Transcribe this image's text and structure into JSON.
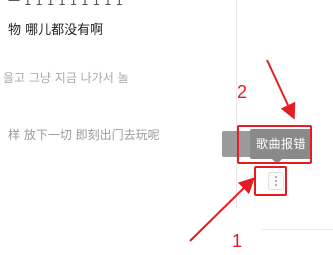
{
  "lyrics": {
    "line0": "一 1 1 1 1 1 1 1 1 1",
    "line1": "物 哪儿都没有啊",
    "line2": "을고 그냥 지금 나가서 놀",
    "line3": "样 放下一切 即刻出门去玩呢"
  },
  "tooltip": {
    "label": "歌曲报错"
  },
  "annotations": {
    "num1": "1",
    "num2": "2"
  },
  "colors": {
    "annotation": "#e51c23",
    "tooltip_bg": "#8a8a8a"
  },
  "icons": {
    "more": "more-vertical-icon"
  }
}
